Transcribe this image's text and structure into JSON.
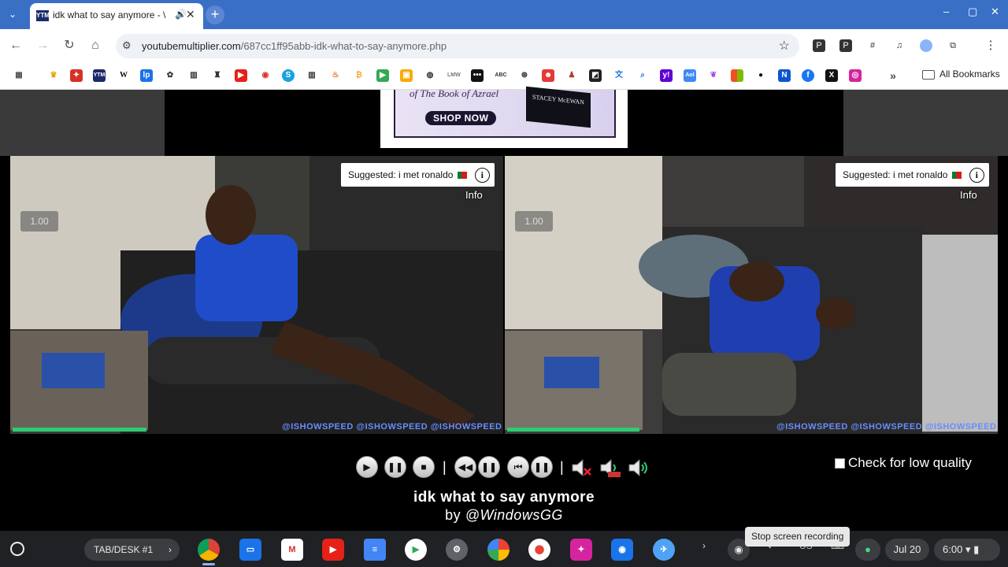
{
  "browser": {
    "tab": {
      "title": "idk what to say anymore - \\",
      "favicon_text": "YTM"
    },
    "new_tab": "+",
    "window_controls": [
      "–",
      "▢",
      "✕"
    ],
    "url_domain": "youtubemultiplier.com",
    "url_path": "/687cc1ff95abb-idk-what-to-say-anymore.php",
    "all_bookmarks": "All Bookmarks"
  },
  "ad": {
    "line": "of The Book of Azrael",
    "shop_now": "SHOP NOW",
    "book_author": "STACEY McEWAN"
  },
  "videos": [
    {
      "suggested": "Suggested: i met ronaldo",
      "info": "Info",
      "speed": "1.00",
      "watermark": "@ISHOWSPEED  @ISHOWSPEED  @ISHOWSPEED"
    },
    {
      "suggested": "Suggested: i met ronaldo",
      "info": "Info",
      "speed": "1.00",
      "watermark": "@ISHOWSPEED  @ISHOWSPEED  @ISHOWSPEED"
    }
  ],
  "controls": {
    "separator": "|",
    "low_quality_label": "Check for low quality"
  },
  "video_title": "idk what to say anymore",
  "video_by_prefix": "by",
  "video_by_author": "@WindowsGG",
  "shelf": {
    "desk_label": "TAB/DESK #1",
    "tooltip": "Stop screen recording",
    "locale": "US",
    "date": "Jul 20",
    "time": "6:00"
  },
  "colors": {
    "tabstrip": "#3a6fc6",
    "shelf": "#202124",
    "omnibox": "#eef1f6"
  }
}
